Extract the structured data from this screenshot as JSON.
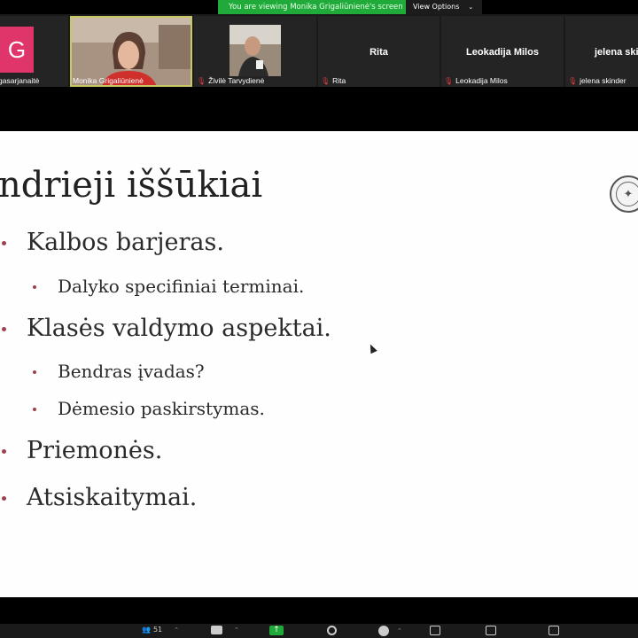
{
  "banner": {
    "text": "You are viewing Monika Grigaliūnienė's screen",
    "view_options": "View Options"
  },
  "participants": [
    {
      "name": "gasarjanaitė",
      "initial": "G",
      "avatar_color": "#e0356b",
      "muted": false
    },
    {
      "name": "Monika Grigaliūnienė",
      "muted": false,
      "active": true
    },
    {
      "name": "Živilė Tarvydienė",
      "muted": true
    },
    {
      "name": "Rita",
      "display": "Rita",
      "muted": true
    },
    {
      "name": "Leokadija Milos",
      "display": "Leokadija Milos",
      "muted": true
    },
    {
      "name": "jelena skinder",
      "display": "jelena skir",
      "muted": true
    }
  ],
  "slide": {
    "title": "ndrieji iššūkiai",
    "bullets": [
      {
        "text": "Kalbos barjeras.",
        "sub": [
          "Dalyko specifiniai terminai."
        ]
      },
      {
        "text": "Klasės valdymo aspektai.",
        "sub": [
          "Bendras įvadas?",
          "Dėmesio paskirstymas."
        ]
      },
      {
        "text": "Priemonės.",
        "sub": []
      },
      {
        "text": "Atsiskaitymai.",
        "sub": []
      }
    ]
  },
  "toolbar": {
    "participants_count": "51"
  }
}
